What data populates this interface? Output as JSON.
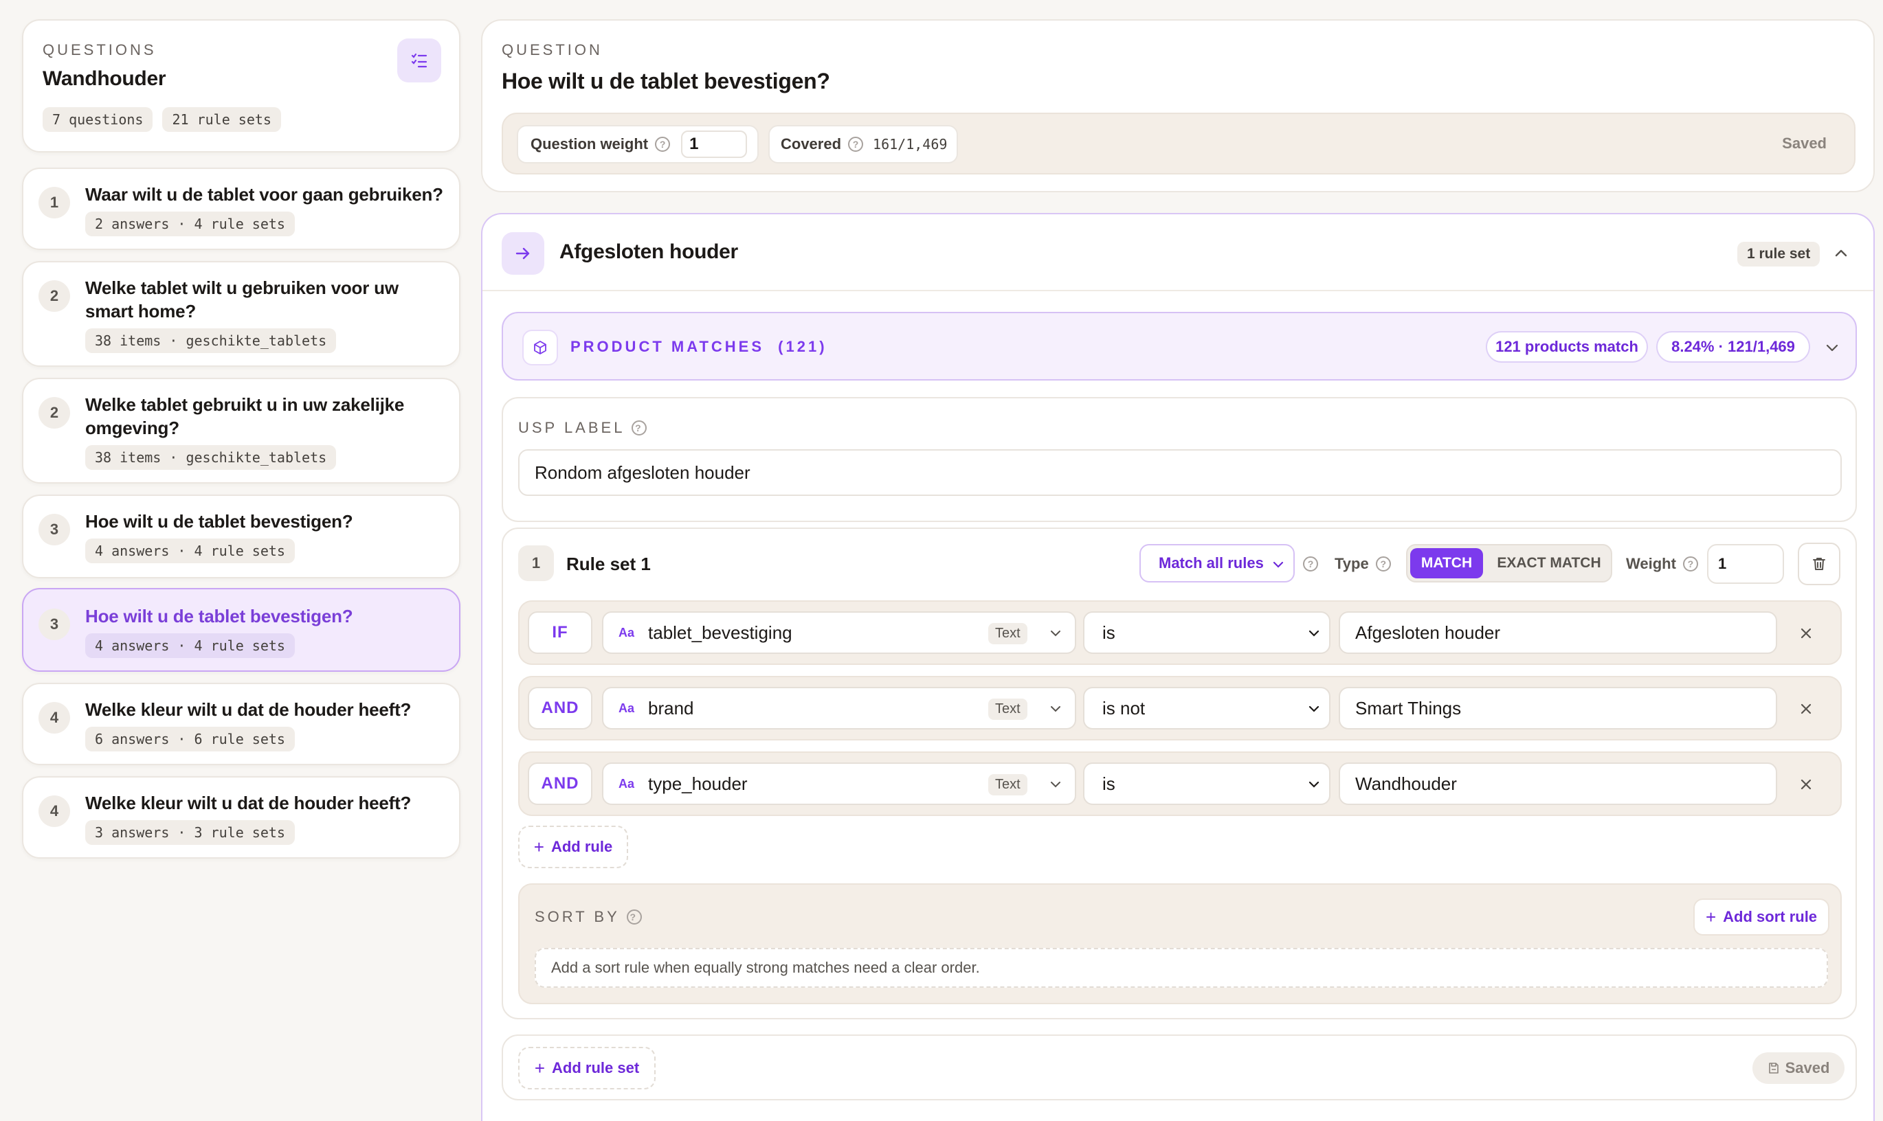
{
  "sidebar": {
    "eyebrow": "QUESTIONS",
    "title": "Wandhouder",
    "chips": [
      "7 questions",
      "21 rule sets"
    ],
    "questions": [
      {
        "num": "1",
        "title": "Waar wilt u de tablet voor gaan gebruiken?",
        "meta": "2 answers · 4 rule sets"
      },
      {
        "num": "2",
        "title": "Welke tablet wilt u gebruiken voor uw smart home?",
        "meta": "38 items · geschikte_tablets"
      },
      {
        "num": "2",
        "title": "Welke tablet gebruikt u in uw zakelijke omgeving?",
        "meta": "38 items · geschikte_tablets"
      },
      {
        "num": "3",
        "title": "Hoe wilt u de tablet bevestigen?",
        "meta": "4 answers · 4 rule sets"
      },
      {
        "num": "3",
        "title": "Hoe wilt u de tablet bevestigen?",
        "meta": "4 answers · 4 rule sets",
        "active": true
      },
      {
        "num": "4",
        "title": "Welke kleur wilt u dat de houder heeft?",
        "meta": "6 answers · 6 rule sets"
      },
      {
        "num": "4",
        "title": "Welke kleur wilt u dat de houder heeft?",
        "meta": "3 answers · 3 rule sets"
      }
    ]
  },
  "question": {
    "eyebrow": "QUESTION",
    "title": "Hoe wilt u de tablet bevestigen?",
    "weight_label": "Question weight",
    "weight_value": "1",
    "covered_label": "Covered",
    "covered_value": "161/1,469",
    "status": "Saved"
  },
  "answer": {
    "title": "Afgesloten houder",
    "rule_set_count": "1 rule set",
    "product_matches_label": "PRODUCT MATCHES",
    "product_matches_count": "(121)",
    "products_match_badge": "121 products match",
    "ratio_badge": "8.24% · 121/1,469",
    "usp_label": "USP LABEL",
    "usp_value": "Rondom afgesloten houder"
  },
  "rule_set": {
    "index": "1",
    "title": "Rule set 1",
    "match_mode": "Match all rules",
    "type_label": "Type",
    "type_options": [
      "MATCH",
      "EXACT MATCH"
    ],
    "type_selected": "MATCH",
    "weight_label": "Weight",
    "weight_value": "1",
    "rules": [
      {
        "keyword": "IF",
        "field_icon": "Aa",
        "field": "tablet_bevestiging",
        "field_type": "Text",
        "operator": "is",
        "value": "Afgesloten houder"
      },
      {
        "keyword": "AND",
        "field_icon": "Aa",
        "field": "brand",
        "field_type": "Text",
        "operator": "is not",
        "value": "Smart Things"
      },
      {
        "keyword": "AND",
        "field_icon": "Aa",
        "field": "type_houder",
        "field_type": "Text",
        "operator": "is",
        "value": "Wandhouder"
      }
    ],
    "add_rule": "Add rule",
    "sort_by_label": "SORT BY",
    "add_sort_rule": "Add sort rule",
    "sort_empty": "Add a sort rule when equally strong matches need a clear order."
  },
  "footer": {
    "add_rule_set": "Add rule set",
    "status": "Saved"
  },
  "colors": {
    "accent": "#7c3aed",
    "background": "#f8f6f3",
    "beige": "#f4eee7",
    "lilac": "#f3eafd"
  }
}
